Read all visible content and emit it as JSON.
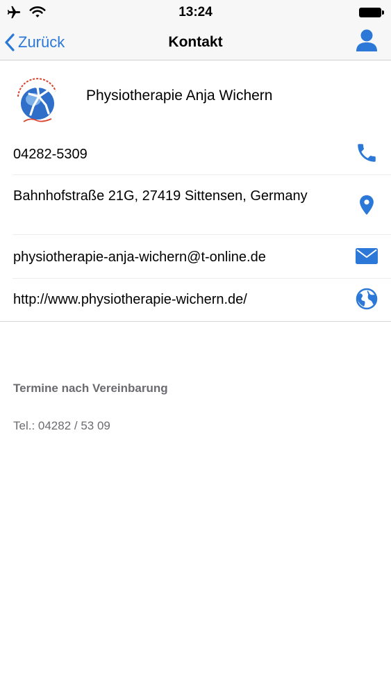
{
  "status_bar": {
    "time": "13:24",
    "icons": [
      "airplane-icon",
      "wifi-icon",
      "battery-icon"
    ]
  },
  "nav": {
    "back_label": "Zurück",
    "title": "Kontakt",
    "right_icon": "person-icon"
  },
  "contact": {
    "logo_icon": "physiotherapy-logo",
    "name": "Physiotherapie Anja Wichern",
    "phone": "04282-5309",
    "address": "Bahnhofstraße 21G, 27419 Sittensen, Germany",
    "email": "physiotherapie-anja-wichern@t-online.de",
    "website": "http://www.physiotherapie-wichern.de/"
  },
  "info": {
    "hours": "Termine nach Vereinbarung",
    "tel": "Tel.: 04282 / 53 09"
  },
  "colors": {
    "accent": "#2b78d8",
    "bar_background": "#f7f7f8",
    "secondary_text": "#6b6b70",
    "separator": "#ececef"
  }
}
